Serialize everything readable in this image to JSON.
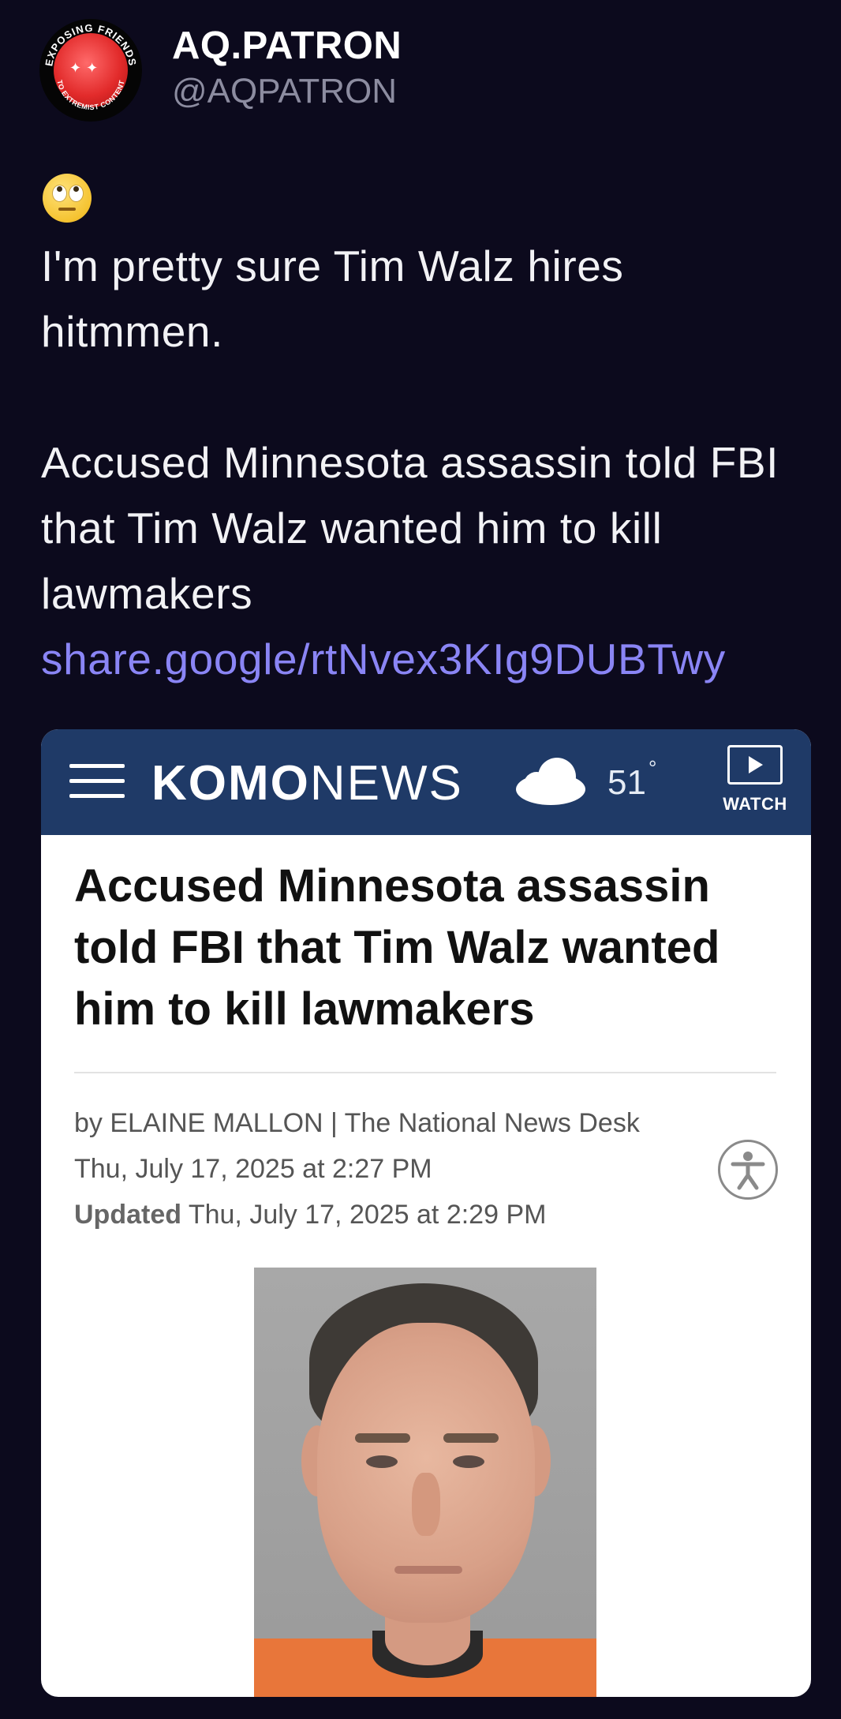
{
  "post": {
    "author": {
      "display_name": "AQ.PATRON",
      "handle": "@AQPATRON",
      "avatar_ring_text": "EXPOSING FRIENDS TO EXTREMIST CONTENT",
      "avatar_ring_top": "EXPOSING FRIENDS",
      "avatar_ring_bottom": "TO EXTREMIST CONTENT"
    },
    "emoji": "face-with-rolling-eyes",
    "line1": "I'm pretty sure Tim Walz hires hitmmen.",
    "line2": "Accused Minnesota assassin told FBI that Tim Walz wanted him to kill lawmakers",
    "link_text": "share.google/rtNvex3KIg9DUBTwy"
  },
  "card": {
    "brand_bold": "KOMO",
    "brand_light": "NEWS",
    "temperature": "51",
    "degree": "°",
    "watch_label": "WATCH",
    "headline": "Accused Minnesota assassin told FBI that Tim Walz wanted him to kill lawmakers",
    "byline": "by ELAINE MALLON | The National News Desk",
    "published": "Thu, July 17, 2025 at 2:27 PM",
    "updated_label": "Updated",
    "updated": "Thu, July 17, 2025 at 2:29 PM",
    "colors": {
      "bar": "#1f3a67",
      "link": "#8a85f5",
      "background": "#0c0a1d"
    }
  }
}
